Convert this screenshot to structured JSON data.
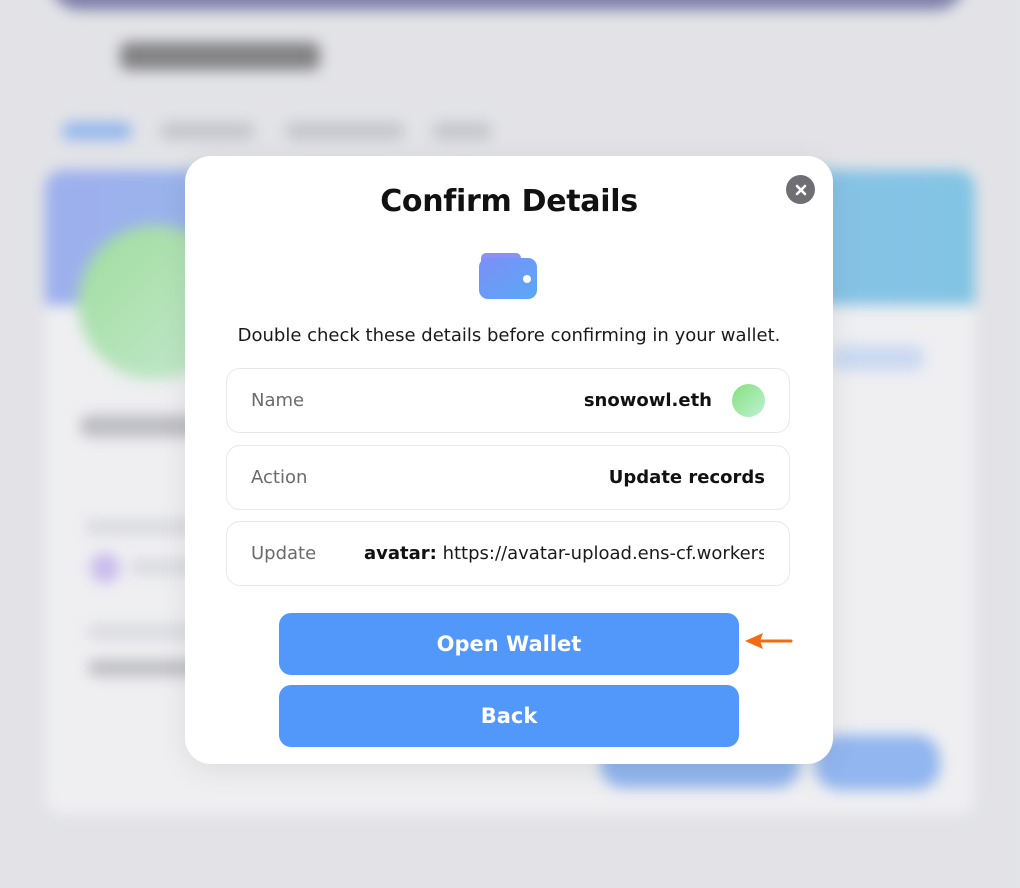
{
  "modal": {
    "title": "Confirm Details",
    "subtitle": "Double check these details before confirming in your wallet.",
    "rows": [
      {
        "label": "Name",
        "value": "snowowl.eth"
      },
      {
        "label": "Action",
        "value": "Update records"
      },
      {
        "label": "Update",
        "key": "avatar:",
        "value": "https://avatar-upload.ens-cf.workers...."
      }
    ],
    "primary_button": "Open Wallet",
    "secondary_button": "Back"
  },
  "icons": {
    "close": "close-icon",
    "wallet": "wallet-icon",
    "avatar": "avatar",
    "arrow": "arrow-left-icon"
  },
  "colors": {
    "accent": "#5298fb",
    "annotation_arrow": "#f46a0e",
    "close_button": "#6f6f73"
  }
}
